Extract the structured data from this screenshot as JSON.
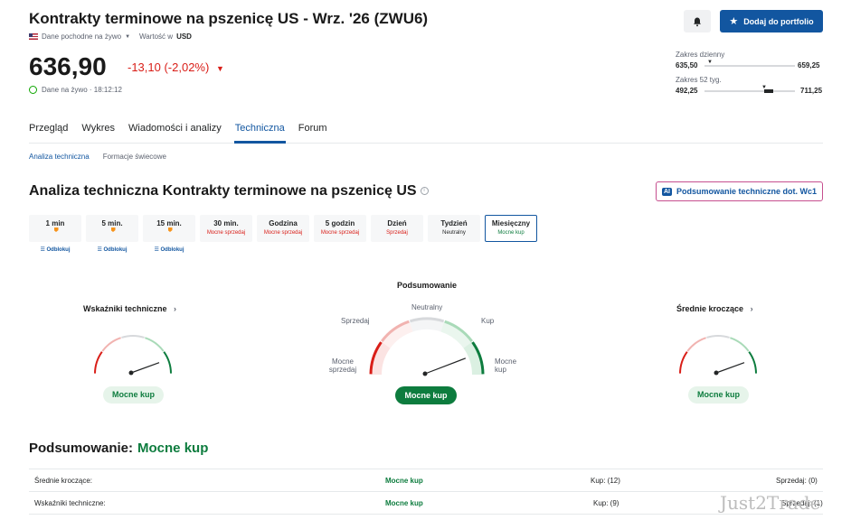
{
  "header": {
    "title": "Kontrakty terminowe na pszenicę US - Wrz. '26 (ZWU6)",
    "data_type": "Dane pochodne na żywo",
    "currency_label": "Wartość w",
    "currency": "USD",
    "add_portfolio_label": "Dodaj do portfolio"
  },
  "quote": {
    "price": "636,90",
    "change": "-13,10 (-2,02%)",
    "live_label": "Dane na żywo · 18:12:12"
  },
  "ranges": {
    "daily_label": "Zakres dzienny",
    "daily_low": "635,50",
    "daily_high": "659,25",
    "daily_position": 0.06,
    "week52_label": "Zakres 52 tyg.",
    "week52_low": "492,25",
    "week52_high": "711,25",
    "week52_position": 0.66
  },
  "tabs": [
    "Przegląd",
    "Wykres",
    "Wiadomości i analizy",
    "Techniczna",
    "Forum"
  ],
  "active_tab": "Techniczna",
  "subtabs": [
    "Analiza techniczna",
    "Formacje świecowe"
  ],
  "section_title": "Analiza techniczna Kontrakty terminowe na pszenicę US",
  "ai_button": {
    "badge": "AI",
    "label": "Podsumowanie techniczne dot. Wc1"
  },
  "periods": [
    {
      "label": "1 min",
      "status": "Odblokuj",
      "kind": "unlock"
    },
    {
      "label": "5 min.",
      "status": "Odblokuj",
      "kind": "unlock"
    },
    {
      "label": "15 min.",
      "status": "Odblokuj",
      "kind": "unlock"
    },
    {
      "label": "30 min.",
      "status": "Mocne sprzedaj",
      "kind": "sell"
    },
    {
      "label": "Godzina",
      "status": "Mocne sprzedaj",
      "kind": "sell"
    },
    {
      "label": "5 godzin",
      "status": "Mocne sprzedaj",
      "kind": "sell"
    },
    {
      "label": "Dzień",
      "status": "Sprzedaj",
      "kind": "sell"
    },
    {
      "label": "Tydzień",
      "status": "Neutralny",
      "kind": "neutral"
    },
    {
      "label": "Miesięczny",
      "status": "Mocne kup",
      "kind": "buy",
      "active": true
    }
  ],
  "gauges": {
    "left": {
      "title": "Wskaźniki techniczne",
      "result": "Mocne kup",
      "needle": 0.92
    },
    "center": {
      "title": "Podsumowanie",
      "result": "Mocne kup",
      "needle": 0.92,
      "labels": {
        "strong_sell": "Mocne sprzedaj",
        "sell": "Sprzedaj",
        "neutral": "Neutralny",
        "buy": "Kup",
        "strong_buy": "Mocne kup"
      }
    },
    "right": {
      "title": "Średnie kroczące",
      "result": "Mocne kup",
      "needle": 0.92
    }
  },
  "summary": {
    "heading": "Podsumowanie:",
    "value": "Mocne kup",
    "rows": [
      {
        "name": "Średnie kroczące:",
        "value": "Mocne kup",
        "buy": "Kup: (12)",
        "sell": "Sprzedaj: (0)"
      },
      {
        "name": "Wskaźniki techniczne:",
        "value": "Mocne kup",
        "buy": "Kup: (9)",
        "sell": "Sprzedaj: (1)"
      }
    ]
  },
  "watermark": "Just2Trade",
  "colors": {
    "accent": "#1256a0",
    "sell": "#d91e18",
    "buy": "#0d7c3e"
  }
}
